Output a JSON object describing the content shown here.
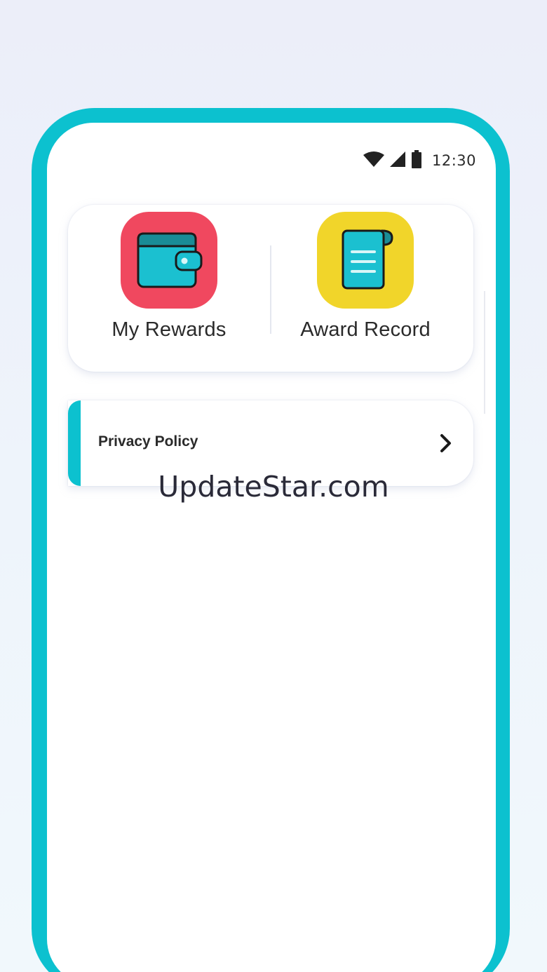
{
  "status_bar": {
    "time": "12:30",
    "icons": [
      "wifi-icon",
      "cell-signal-icon",
      "battery-icon"
    ]
  },
  "shortcuts": [
    {
      "label": "My Rewards",
      "icon": "wallet-icon",
      "color": "#f0485f"
    },
    {
      "label": "Award Record",
      "icon": "receipt-scroll-icon",
      "color": "#f1d52a"
    }
  ],
  "menu": {
    "privacy_policy_label": "Privacy Policy",
    "chevron_icon": "chevron-right-icon"
  },
  "watermark": "UpdateStar.com",
  "colors": {
    "frame": "#0cc1cf",
    "accent": "#0cc1cf",
    "icon_inner": "#1bc0d0"
  }
}
